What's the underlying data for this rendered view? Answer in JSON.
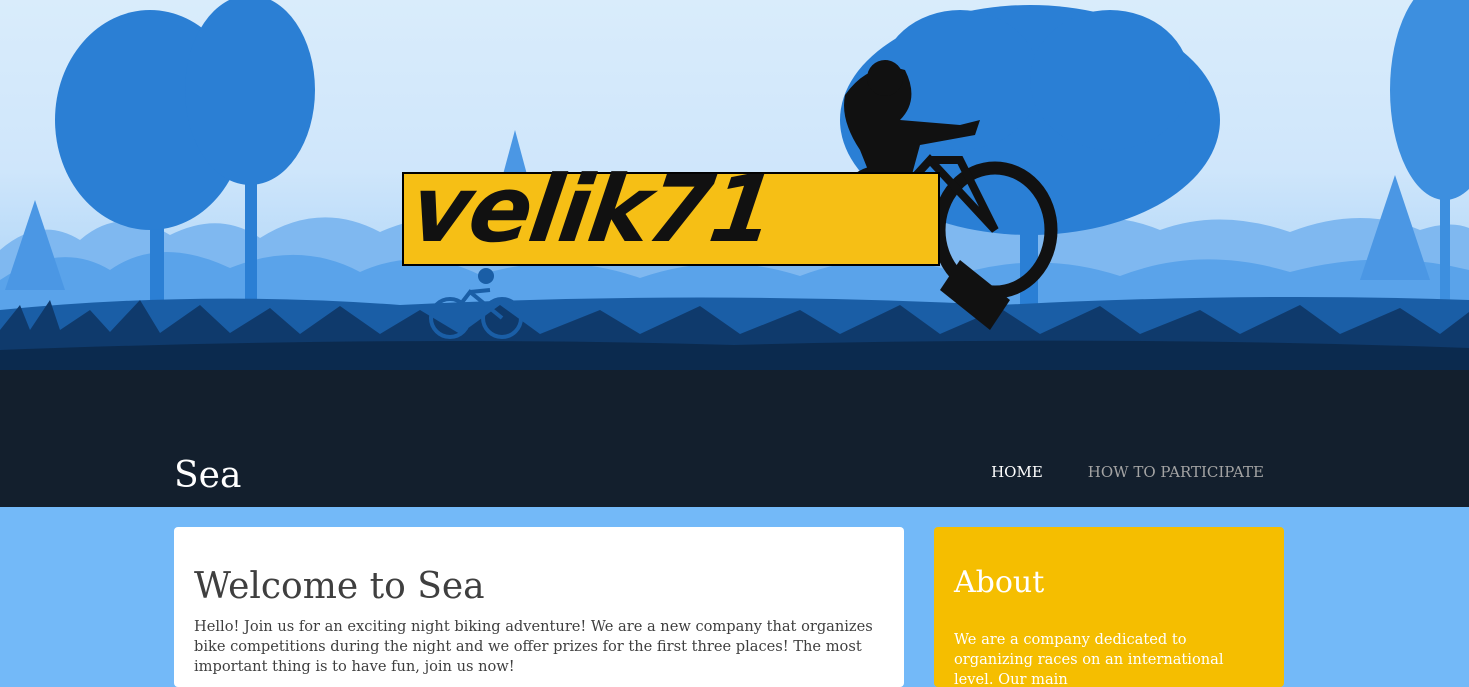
{
  "logo": {
    "text": "velik71"
  },
  "header": {
    "site_title": "Sea",
    "nav": [
      {
        "label": "HOME",
        "active": true
      },
      {
        "label": "HOW TO PARTICIPATE",
        "active": false
      }
    ]
  },
  "main": {
    "heading": "Welcome to Sea",
    "body": "Hello! Join us for an exciting night biking adventure! We are a new company that organizes bike competitions during the night and we offer prizes for the first three places! The most important thing is to have fun, join us now!"
  },
  "sidebar": {
    "heading": "About",
    "body": "We are a company dedicated to organizing races on an international level. Our main"
  },
  "colors": {
    "page_bg": "#73b9f8",
    "nav_bg": "#131f2d",
    "accent_yellow": "#f5be00",
    "tree_dark": "#1f6fc4",
    "tree_light": "#4f9ae6"
  }
}
